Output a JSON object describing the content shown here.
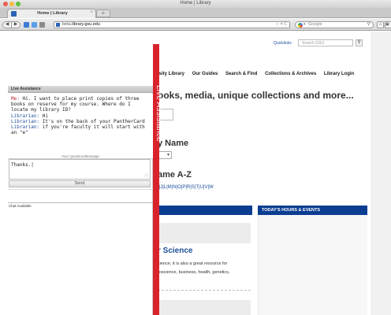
{
  "window": {
    "title": "Home | Library"
  },
  "tabs": [
    {
      "label": "Home | Library",
      "close": "×"
    }
  ],
  "new_tab_label": "+",
  "toolbar": {
    "back": "◀",
    "forward": "▶",
    "url_prefix": "beta.",
    "url_main": "library.gsu.edu",
    "url_icons": "☆ ▾ C",
    "search_placeholder": "Google",
    "search_engine_caret": "▾",
    "search_icon": "magnifier-icon",
    "home_icon": "⌂",
    "ext_icon": "▣"
  },
  "site_header": {
    "quicklinks": "Quicklinks",
    "search_placeholder": "Search GSU",
    "search_icon": "magnifier-icon"
  },
  "nav": {
    "items": [
      "ersity Library",
      "Our Guides",
      "Search & Find",
      "Collections & Archives",
      "Library Login"
    ]
  },
  "hero": {
    "headline": "ooks, media, unique collections and more..."
  },
  "databases": {
    "by_name_heading": "y Name",
    "select_caret": "▾",
    "az_heading": "ame A-Z",
    "letters": "I|J|L|M|N|O|P|R|S|T|U|V|W"
  },
  "hours": {
    "label": "TODAY'S HOURS & EVENTS"
  },
  "feature": {
    "title": "r Science",
    "text_line1": "cience, it is also a great resource for",
    "text_line2": "roscience, business, health, genetics,"
  },
  "live_assistance": {
    "header_title": "Live Assistance",
    "tab_label": "Live Assistance",
    "messages": [
      {
        "speaker": "Me:",
        "text": " Hi. I want to place print copies of three books on reserve for my course. Where do I locate my library ID?"
      },
      {
        "speaker": "Librarian:",
        "text": " Hi"
      },
      {
        "speaker": "Librarian:",
        "text": " It's on the back of your PantherCard"
      },
      {
        "speaker": "Librarian:",
        "text": " if you're faculty it will start with an \"e\""
      }
    ],
    "question_label": "Your Question/Message",
    "input_value": "Thanks.|",
    "send_label": "Send",
    "status": "Chat Available"
  },
  "colors": {
    "gsu_blue": "#0b3d91",
    "live_red": "#d9232c",
    "link_blue": "#1b4e9a"
  }
}
